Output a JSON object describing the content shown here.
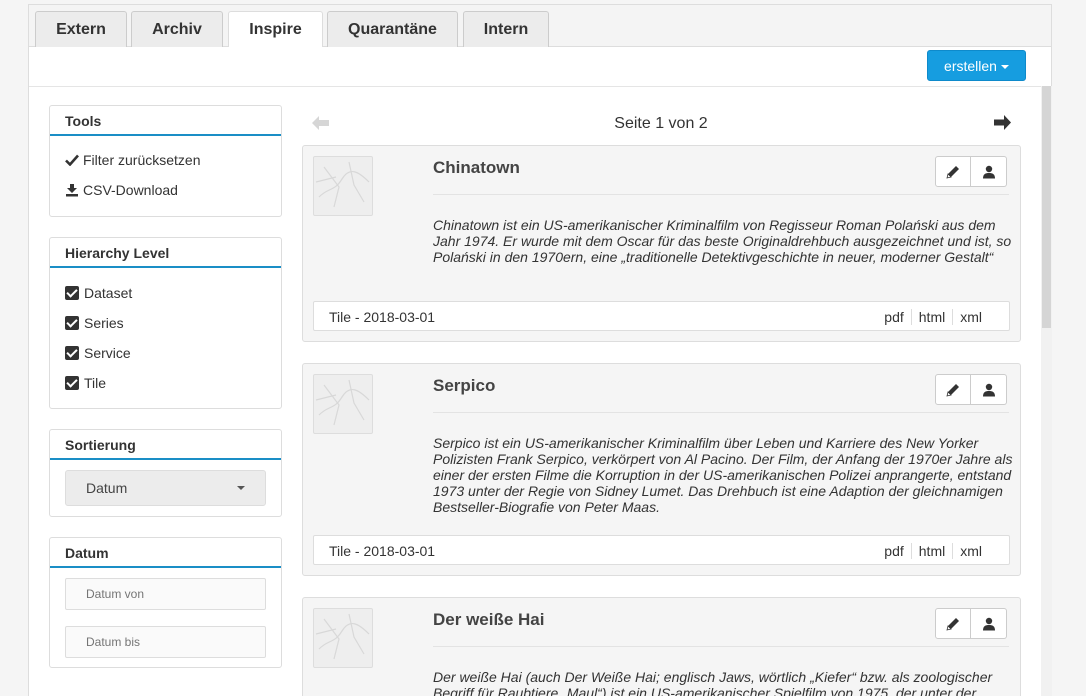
{
  "tabs": [
    {
      "label": "Extern"
    },
    {
      "label": "Archiv"
    },
    {
      "label": "Inspire"
    },
    {
      "label": "Quarantäne"
    },
    {
      "label": "Intern"
    }
  ],
  "toolbar": {
    "create_label": "erstellen"
  },
  "sidebar": {
    "tools": {
      "heading": "Tools",
      "items": [
        {
          "label": "Filter zurücksetzen",
          "icon": "check-icon"
        },
        {
          "label": "CSV-Download",
          "icon": "download-icon"
        }
      ]
    },
    "hierarchy": {
      "heading": "Hierarchy Level",
      "items": [
        {
          "label": "Dataset",
          "checked": true
        },
        {
          "label": "Series",
          "checked": true
        },
        {
          "label": "Service",
          "checked": true
        },
        {
          "label": "Tile",
          "checked": true
        }
      ]
    },
    "sort": {
      "heading": "Sortierung",
      "selected": "Datum"
    },
    "date": {
      "heading": "Datum",
      "from_placeholder": "Datum von",
      "to_placeholder": "Datum bis"
    }
  },
  "pager": {
    "text": "Seite 1 von 2"
  },
  "results": [
    {
      "title": "Chinatown",
      "description": "Chinatown ist ein US-amerikanischer Kriminalfilm von Regisseur Roman Polański aus dem Jahr 1974. Er wurde mit dem Oscar für das beste Originaldrehbuch ausgezeichnet und ist, so Polański in den 1970ern, eine „traditionelle Detektivgeschichte in neuer, moderner Gestalt“",
      "meta": "Tile - 2018-03-01",
      "formats": [
        "pdf",
        "html",
        "xml"
      ]
    },
    {
      "title": "Serpico",
      "description": "Serpico ist ein US-amerikanischer Kriminalfilm über Leben und Karriere des New Yorker Polizisten Frank Serpico, verkörpert von Al Pacino. Der Film, der Anfang der 1970er Jahre als einer der ersten Filme die Korruption in der US-amerikanischen Polizei anprangerte, entstand 1973 unter der Regie von Sidney Lumet. Das Drehbuch ist eine Adaption der gleichnamigen Bestseller-Biografie von Peter Maas.",
      "meta": "Tile - 2018-03-01",
      "formats": [
        "pdf",
        "html",
        "xml"
      ]
    },
    {
      "title": "Der weiße Hai",
      "description": "Der weiße Hai (auch Der Weiße Hai; englisch Jaws, wörtlich „Kiefer“ bzw. als zoologischer Begriff für Raubtiere „Maul“) ist ein US-amerikanischer Spielfilm von 1975, der unter der",
      "meta": "",
      "formats": []
    }
  ]
}
